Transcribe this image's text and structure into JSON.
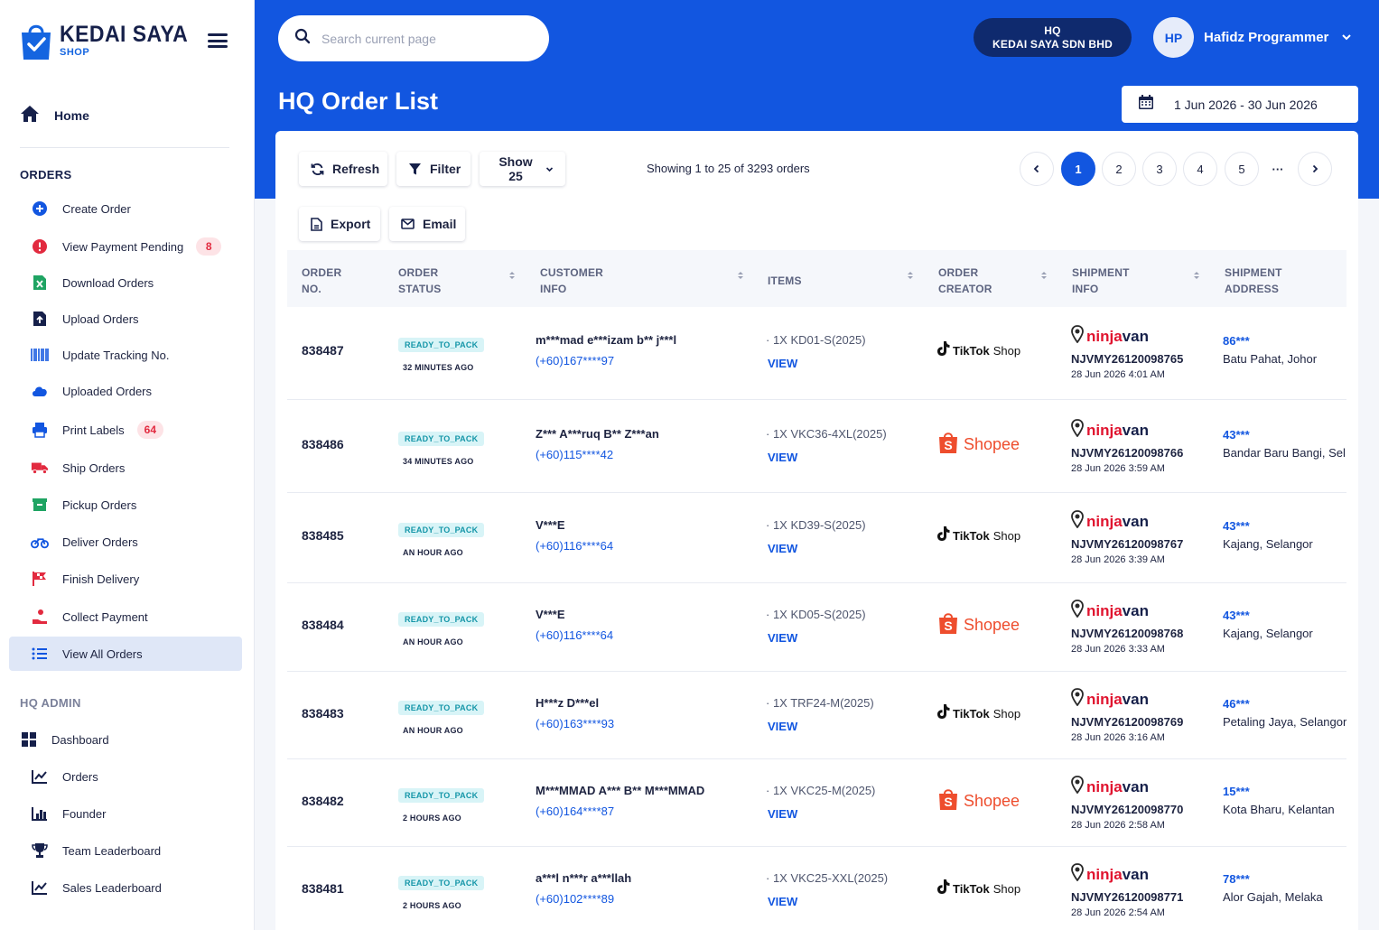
{
  "brand": {
    "name": "KEDAI SAYA",
    "sub": "SHOP"
  },
  "search": {
    "placeholder": "Search current page"
  },
  "hq": {
    "line1": "HQ",
    "line2": "KEDAI SAYA SDN BHD"
  },
  "user": {
    "initials": "HP",
    "name": "Hafidz Programmer"
  },
  "page": {
    "title": "HQ Order List",
    "date_range": "1 Jun 2026 - 30 Jun 2026"
  },
  "sidebar": {
    "home": "Home",
    "orders_title": "ORDERS",
    "orders": [
      {
        "label": "Create Order",
        "icon": "plus-circle-icon"
      },
      {
        "label": "View Payment Pending",
        "icon": "alert-circle-icon",
        "badge": "8"
      },
      {
        "label": "Download Orders",
        "icon": "excel-icon"
      },
      {
        "label": "Upload Orders",
        "icon": "file-upload-icon"
      },
      {
        "label": "Update Tracking No.",
        "icon": "barcode-icon"
      },
      {
        "label": "Uploaded Orders",
        "icon": "cloud-icon"
      },
      {
        "label": "Print Labels",
        "icon": "printer-icon",
        "badge": "64"
      },
      {
        "label": "Ship Orders",
        "icon": "truck-icon"
      },
      {
        "label": "Pickup Orders",
        "icon": "box-icon"
      },
      {
        "label": "Deliver Orders",
        "icon": "motorbike-icon"
      },
      {
        "label": "Finish Delivery",
        "icon": "flag-icon"
      },
      {
        "label": "Collect Payment",
        "icon": "hand-coin-icon"
      },
      {
        "label": "View All Orders",
        "icon": "list-icon",
        "active": true
      }
    ],
    "admin_title": "HQ ADMIN",
    "admin": [
      {
        "label": "Dashboard",
        "icon": "dashboard-icon"
      },
      {
        "label": "Orders",
        "icon": "chart-line-icon"
      },
      {
        "label": "Founder",
        "icon": "chart-bar-icon"
      },
      {
        "label": "Team Leaderboard",
        "icon": "trophy-icon"
      },
      {
        "label": "Sales Leaderboard",
        "icon": "chart-line-icon"
      }
    ]
  },
  "toolbar": {
    "refresh": "Refresh",
    "filter": "Filter",
    "show": "Show 25",
    "export": "Export",
    "email": "Email",
    "showing": "Showing 1 to 25 of 3293 orders"
  },
  "pagination": {
    "pages": [
      "1",
      "2",
      "3",
      "4",
      "5"
    ],
    "active": "1",
    "ellipsis": "···"
  },
  "table": {
    "headers": {
      "order_no": [
        "ORDER",
        "NO."
      ],
      "order_status": [
        "ORDER",
        "STATUS"
      ],
      "customer_info": [
        "CUSTOMER",
        "INFO"
      ],
      "items": [
        "ITEMS"
      ],
      "order_creator": [
        "ORDER",
        "CREATOR"
      ],
      "shipment_info": [
        "SHIPMENT",
        "INFO"
      ],
      "shipment_address": [
        "SHIPMENT",
        "ADDRESS"
      ]
    },
    "view_label": "VIEW",
    "courier": {
      "ninja": "ninja",
      "van": "van"
    },
    "creators": {
      "tiktok_word": "TikTok",
      "tiktok_shop": "Shop",
      "shopee_word": "Shopee"
    },
    "rows": [
      {
        "order_no": "838487",
        "status": "READY_TO_PACK",
        "ago": "32 MINUTES AGO",
        "customer": "m***mad e***izam b** j***l",
        "phone": "(+60)167****97",
        "item": "· 1X KD01-S(2025)",
        "creator": "tiktok",
        "tracking": "NJVMY26120098765",
        "ship_date": "28 Jun 2026 4:01 AM",
        "postcode": "86***",
        "address": "Batu Pahat, Johor"
      },
      {
        "order_no": "838486",
        "status": "READY_TO_PACK",
        "ago": "34 MINUTES AGO",
        "customer": "Z*** A***ruq B** Z***an",
        "phone": "(+60)115****42",
        "item": "· 1X VKC36-4XL(2025)",
        "creator": "shopee",
        "tracking": "NJVMY26120098766",
        "ship_date": "28 Jun 2026 3:59 AM",
        "postcode": "43***",
        "address": "Bandar Baru Bangi, Sel"
      },
      {
        "order_no": "838485",
        "status": "READY_TO_PACK",
        "ago": "AN HOUR AGO",
        "customer": "V***E",
        "phone": "(+60)116****64",
        "item": "· 1X KD39-S(2025)",
        "creator": "tiktok",
        "tracking": "NJVMY26120098767",
        "ship_date": "28 Jun 2026 3:39 AM",
        "postcode": "43***",
        "address": "Kajang, Selangor"
      },
      {
        "order_no": "838484",
        "status": "READY_TO_PACK",
        "ago": "AN HOUR AGO",
        "customer": "V***E",
        "phone": "(+60)116****64",
        "item": "· 1X KD05-S(2025)",
        "creator": "shopee",
        "tracking": "NJVMY26120098768",
        "ship_date": "28 Jun 2026 3:33 AM",
        "postcode": "43***",
        "address": "Kajang, Selangor"
      },
      {
        "order_no": "838483",
        "status": "READY_TO_PACK",
        "ago": "AN HOUR AGO",
        "customer": "H***z D***el",
        "phone": "(+60)163****93",
        "item": "· 1X TRF24-M(2025)",
        "creator": "tiktok",
        "tracking": "NJVMY26120098769",
        "ship_date": "28 Jun 2026 3:16 AM",
        "postcode": "46***",
        "address": "Petaling Jaya, Selangor"
      },
      {
        "order_no": "838482",
        "status": "READY_TO_PACK",
        "ago": "2 HOURS AGO",
        "customer": "M***MMAD A*** B** M***MMAD",
        "phone": "(+60)164****87",
        "item": "· 1X VKC25-M(2025)",
        "creator": "shopee",
        "tracking": "NJVMY26120098770",
        "ship_date": "28 Jun 2026 2:58 AM",
        "postcode": "15***",
        "address": "Kota Bharu, Kelantan"
      },
      {
        "order_no": "838481",
        "status": "READY_TO_PACK",
        "ago": "2 HOURS AGO",
        "customer": "a***l n***r a***llah",
        "phone": "(+60)102****89",
        "item": "· 1X VKC25-XXL(2025)",
        "creator": "tiktok",
        "tracking": "NJVMY26120098771",
        "ship_date": "28 Jun 2026 2:54 AM",
        "postcode": "78***",
        "address": "Alor Gajah, Melaka"
      }
    ]
  },
  "colors": {
    "primary": "#1256e0",
    "navy": "#16204a",
    "danger": "#e22a3f",
    "teal": "#1596a8",
    "shopee": "#ee4d2d"
  }
}
